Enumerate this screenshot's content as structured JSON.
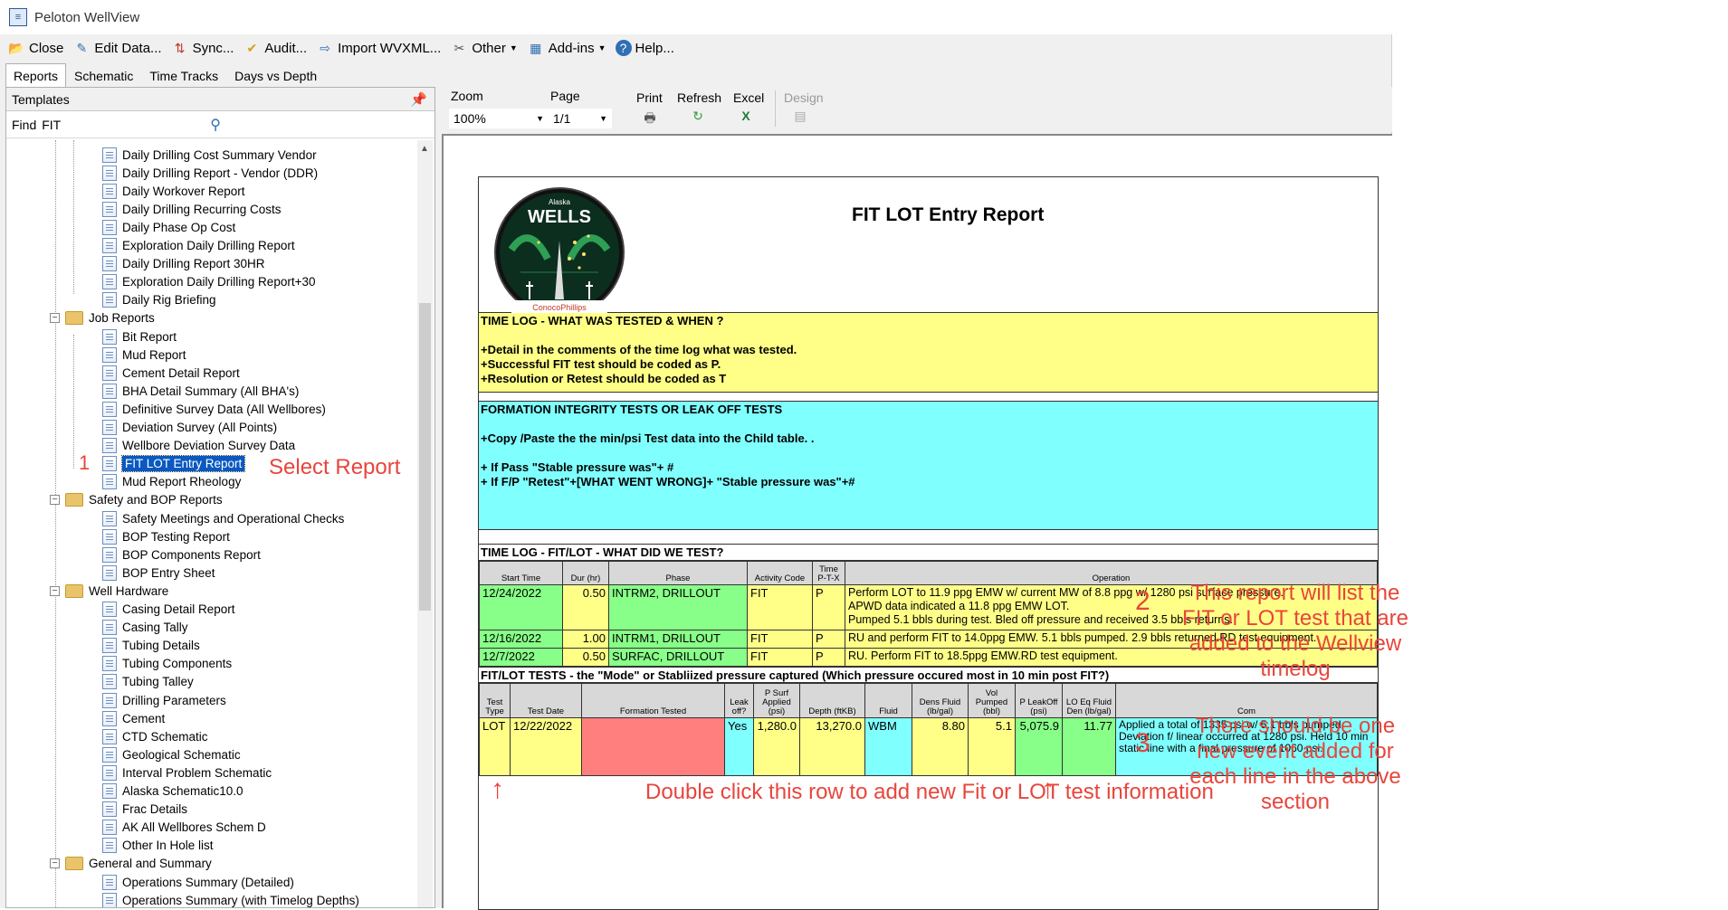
{
  "window": {
    "title": "Peloton WellView"
  },
  "menu": [
    {
      "label": "Close",
      "icon": "close-folder-icon"
    },
    {
      "label": "Edit Data...",
      "icon": "edit-icon"
    },
    {
      "label": "Sync...",
      "icon": "sync-icon"
    },
    {
      "label": "Audit...",
      "icon": "audit-icon"
    },
    {
      "label": "Import WVXML...",
      "icon": "import-icon"
    },
    {
      "label": "Other",
      "icon": "tools-icon",
      "dropdown": true
    },
    {
      "label": "Add-ins",
      "icon": "addins-icon",
      "dropdown": true
    },
    {
      "label": "Help...",
      "icon": "help-icon"
    }
  ],
  "tabs": [
    "Reports",
    "Schematic",
    "Time Tracks",
    "Days vs Depth"
  ],
  "left_panel": {
    "header": "Templates",
    "find_label": "Find",
    "find_value": "FIT",
    "tree": [
      {
        "label": "Daily Drilling Cost Summary Vendor",
        "type": "doc"
      },
      {
        "label": "Daily Drilling Report - Vendor (DDR)",
        "type": "doc"
      },
      {
        "label": "Daily Workover Report",
        "type": "doc"
      },
      {
        "label": "Daily Drilling Recurring Costs",
        "type": "doc"
      },
      {
        "label": "Daily Phase Op Cost",
        "type": "doc"
      },
      {
        "label": "Exploration Daily Drilling Report",
        "type": "doc"
      },
      {
        "label": "Daily Drilling Report 30HR",
        "type": "doc"
      },
      {
        "label": "Exploration Daily Drilling Report+30",
        "type": "doc"
      },
      {
        "label": "Daily Rig Briefing",
        "type": "doc"
      },
      {
        "label": "Job Reports",
        "type": "folder"
      },
      {
        "label": "Bit Report",
        "type": "doc"
      },
      {
        "label": "Mud Report",
        "type": "doc"
      },
      {
        "label": "Cement Detail Report",
        "type": "doc"
      },
      {
        "label": "BHA Detail Summary (All BHA's)",
        "type": "doc"
      },
      {
        "label": "Definitive Survey Data (All Wellbores)",
        "type": "doc"
      },
      {
        "label": "Deviation Survey (All Points)",
        "type": "doc"
      },
      {
        "label": "Wellbore Deviation Survey Data",
        "type": "doc"
      },
      {
        "label": "FIT LOT Entry Report",
        "type": "doc",
        "selected": true
      },
      {
        "label": "Mud Report Rheology",
        "type": "doc"
      },
      {
        "label": "Safety and BOP Reports",
        "type": "folder"
      },
      {
        "label": "Safety Meetings and Operational Checks",
        "type": "doc"
      },
      {
        "label": "BOP Testing Report",
        "type": "doc"
      },
      {
        "label": "BOP Components Report",
        "type": "doc"
      },
      {
        "label": "BOP Entry Sheet",
        "type": "doc"
      },
      {
        "label": "Well Hardware",
        "type": "folder"
      },
      {
        "label": "Casing Detail Report",
        "type": "doc"
      },
      {
        "label": "Casing Tally",
        "type": "doc"
      },
      {
        "label": "Tubing Details",
        "type": "doc"
      },
      {
        "label": "Tubing Components",
        "type": "doc"
      },
      {
        "label": "Tubing Talley",
        "type": "doc"
      },
      {
        "label": "Drilling Parameters",
        "type": "doc"
      },
      {
        "label": "Cement",
        "type": "doc"
      },
      {
        "label": "CTD Schematic",
        "type": "doc"
      },
      {
        "label": "Geological Schematic",
        "type": "doc"
      },
      {
        "label": "Interval Problem Schematic",
        "type": "doc"
      },
      {
        "label": "Alaska Schematic10.0",
        "type": "doc"
      },
      {
        "label": "Frac Details",
        "type": "doc"
      },
      {
        "label": "AK All Wellbores Schem D",
        "type": "doc"
      },
      {
        "label": "Other In Hole list",
        "type": "doc"
      },
      {
        "label": "General and Summary",
        "type": "folder"
      },
      {
        "label": "Operations Summary (Detailed)",
        "type": "doc"
      },
      {
        "label": "Operations Summary (with Timelog Depths)",
        "type": "doc"
      }
    ]
  },
  "report_toolbar": {
    "zoom_label": "Zoom",
    "zoom_value": "100%",
    "page_label": "Page",
    "page_value": "1/1",
    "print_label": "Print",
    "refresh_label": "Refresh",
    "excel_label": "Excel",
    "design_label": "Design"
  },
  "report": {
    "title": "FIT LOT Entry Report",
    "logo": {
      "top": "Alaska",
      "main": "WELLS",
      "bottom": "ConocoPhillips"
    },
    "timelog_section": {
      "title": "TIME LOG - WHAT WAS TESTED & WHEN ?",
      "lines": [
        "+Detail in the comments of the time log what was tested.",
        "+Successful FIT test should be coded as P.",
        "+Resolution or Retest should be coded as T"
      ]
    },
    "fit_section": {
      "title": "FORMATION INTEGRITY TESTS OR LEAK OFF TESTS",
      "line1": "+Copy /Paste the the min/psi Test data into the Child table. .",
      "line2": "+ If Pass \"Stable pressure was\"+ #",
      "line3": "+ If F/P \"Retest\"+[WHAT WENT WRONG]+ \"Stable pressure was\"+#"
    },
    "timelog_table": {
      "title": "TIME LOG - FIT/LOT -  WHAT DID WE TEST?",
      "headers": [
        "Start Time",
        "Dur (hr)",
        "Phase",
        "Activity Code",
        "Time P-T-X",
        "Operation"
      ],
      "rows": [
        [
          "12/24/2022",
          "0.50",
          "INTRM2, DRILLOUT",
          "FIT",
          "P",
          "Perform LOT to 11.9 ppg EMW w/ current MW of 8.8 ppg w/ 1280 psi surface pressure.",
          "APWD data indicated a 11.8 ppg EMW LOT.",
          "Pumped 5.1 bbls during test.  Bled off pressure and received 3.5 bbls returns."
        ],
        [
          "12/16/2022",
          "1.00",
          "INTRM1, DRILLOUT",
          "FIT",
          "P",
          "RU and perform FIT to 14.0ppg EMW. 5.1 bbls pumped. 2.9 bbls returned.RD test equipment."
        ],
        [
          "12/7/2022",
          "0.50",
          "SURFAC, DRILLOUT",
          "FIT",
          "P",
          "RU. Perform FIT to 18.5ppg EMW.RD test equipment."
        ]
      ]
    },
    "fitlot_table": {
      "title": "FIT/LOT TESTS - the \"Mode\" or Stabliized pressure captured (Which pressure occured most in 10 min post FIT?)",
      "headers": [
        "Test Type",
        "Test Date",
        "Formation Tested",
        "Leak off?",
        "P Surf Applied (psi)",
        "Depth (ftKB)",
        "Fluid",
        "Dens Fluid (lb/gal)",
        "Vol Pumped (bbl)",
        "P LeakOff (psi)",
        "LO Eq Fluid Den (lb/gal)",
        "Com"
      ],
      "row": [
        "LOT",
        "12/22/2022",
        "",
        "Yes",
        "1,280.0",
        "13,270.0",
        "WBM",
        "8.80",
        "5.1",
        "5,075.9",
        "11.77",
        "Applied a total of 1335 psi w/ 5.1 bbls pumped. Deviation f/ linear occurred at 1280 psi.  Held 10 min static line with a final pressure of 1060 psi."
      ]
    }
  },
  "annotations": {
    "step1_num": "1",
    "select_report": "Select Report",
    "step2_num": "2",
    "step2_text": "This report will list the FIT or LOT test that are added to the Wellview timelog",
    "step3_num": "3",
    "step3_text": "There should be one new event added for each line in the above section",
    "double_click": "Double click this row to add new Fit or LOT test information"
  },
  "colors": {
    "annotation": "#e8453c",
    "yellow_cell": "#ffff88",
    "cyan_cell": "#80ffff",
    "green_cell": "#88ff88",
    "red_cell": "#ff7f7f",
    "selection": "#0a59c2"
  }
}
